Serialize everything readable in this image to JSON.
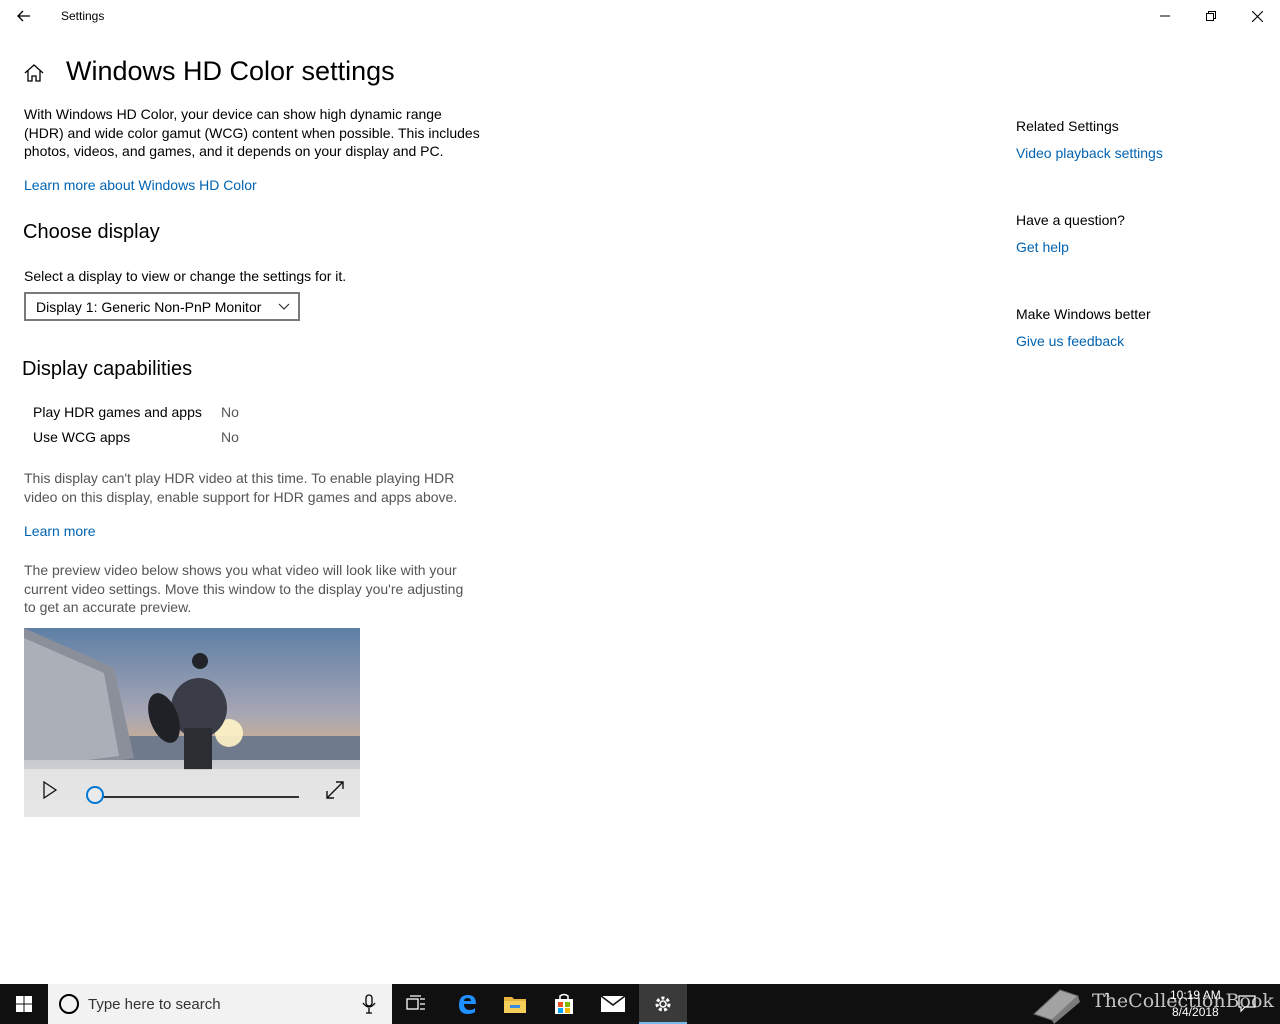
{
  "window": {
    "title": "Settings"
  },
  "page": {
    "title": "Windows HD Color settings",
    "description": "With Windows HD Color, your device can show high dynamic range (HDR) and wide color gamut (WCG) content when possible. This includes photos, videos, and games, and it depends on your display and PC.",
    "learn_more_link": "Learn more about Windows HD Color"
  },
  "choose_display": {
    "heading": "Choose display",
    "instruction": "Select a display to view or change the settings for it.",
    "selected": "Display 1: Generic Non-PnP Monitor"
  },
  "capabilities": {
    "heading": "Display capabilities",
    "rows": [
      {
        "label": "Play HDR games and apps",
        "value": "No"
      },
      {
        "label": "Use WCG apps",
        "value": "No"
      }
    ],
    "note": "This display can't play HDR video at this time. To enable playing HDR video on this display, enable support for HDR games and apps above.",
    "learn_more": "Learn more",
    "preview_text": "The preview video below shows you what video will look like with your current video settings. Move this window to the display you're adjusting to get an accurate preview."
  },
  "video": {
    "progress": 0
  },
  "sidebar": {
    "related_heading": "Related Settings",
    "related_link": "Video playback settings",
    "question_heading": "Have a question?",
    "question_link": "Get help",
    "better_heading": "Make Windows better",
    "better_link": "Give us feedback"
  },
  "taskbar": {
    "search_placeholder": "Type here to search",
    "time": "10:19 AM",
    "date": "8/4/2018",
    "apps": [
      "start-icon",
      "task-view-icon",
      "edge-icon",
      "file-explorer-icon",
      "store-icon",
      "mail-icon",
      "settings-icon"
    ]
  },
  "watermark": {
    "text": "TheCollectionBook"
  },
  "colors": {
    "accent_link": "#0063b1",
    "taskbar": "#101010",
    "slider_accent": "#0078d7"
  }
}
